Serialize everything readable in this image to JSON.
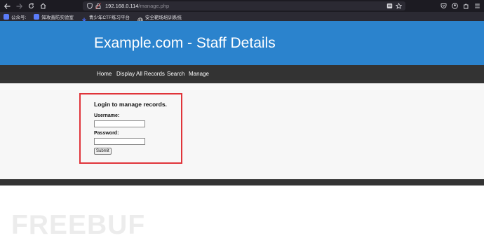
{
  "browser": {
    "url_host": "192.168.0.114",
    "url_path": "/manage.php",
    "bookmarks": [
      {
        "label": "公众号:",
        "color": "#5b7cfa"
      },
      {
        "label": "知攻善防实验室",
        "color": "#5b7cfa"
      },
      {
        "label": "青少年CTF练习平台",
        "color": "#4a6cf7"
      },
      {
        "label": "安全靶场培训系统",
        "color": "#cccccc"
      }
    ]
  },
  "site": {
    "title": "Example.com - Staff Details",
    "nav": [
      "Home",
      "Display All Records",
      "Search",
      "Manage"
    ]
  },
  "login": {
    "heading": "Login to manage records.",
    "username_label": "Username:",
    "password_label": "Password:",
    "username_value": "",
    "password_value": "",
    "submit_label": "Submit"
  },
  "watermark": "FREEBUF",
  "colors": {
    "header": "#2b83cd",
    "nav": "#333333",
    "highlight_box": "#e0343a"
  }
}
